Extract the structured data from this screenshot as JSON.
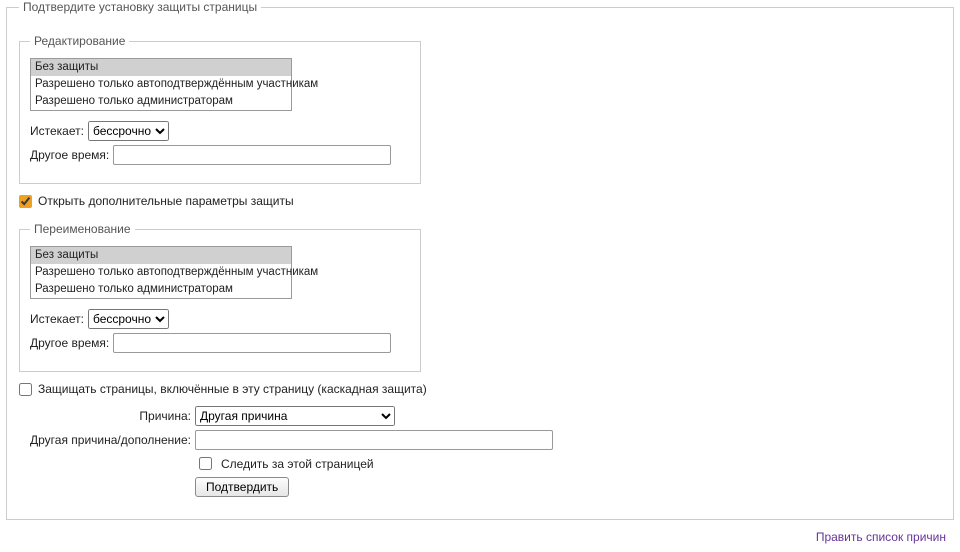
{
  "outer_legend": "Подтвердите установку защиты страницы",
  "sections": {
    "edit": {
      "legend": "Редактирование",
      "options": [
        "Без защиты",
        "Разрешено только автоподтверждённым участникам",
        "Разрешено только администраторам"
      ],
      "selected_index": 0,
      "expires_label": "Истекает:",
      "expires_value": "бессрочно",
      "other_time_label": "Другое время:",
      "other_time_value": ""
    },
    "move": {
      "legend": "Переименование",
      "options": [
        "Без защиты",
        "Разрешено только автоподтверждённым участникам",
        "Разрешено только администраторам"
      ],
      "selected_index": 0,
      "expires_label": "Истекает:",
      "expires_value": "бессрочно",
      "other_time_label": "Другое время:",
      "other_time_value": ""
    }
  },
  "unlock_more_label": "Открыть дополнительные параметры защиты",
  "cascade_label": "Защищать страницы, включённые в эту страницу (каскадная защита)",
  "reason": {
    "label": "Причина:",
    "selected": "Другая причина"
  },
  "other_reason": {
    "label": "Другая причина/дополнение:",
    "value": ""
  },
  "watch_label": "Следить за этой страницей",
  "submit_label": "Подтвердить",
  "footer_link": "Править список причин"
}
